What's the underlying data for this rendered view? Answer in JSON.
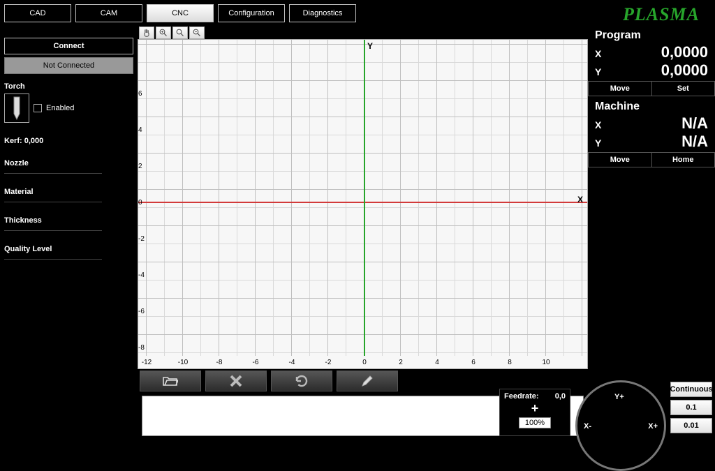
{
  "brand": "PLASMA",
  "tabs": {
    "cad": "CAD",
    "cam": "CAM",
    "cnc": "CNC",
    "config": "Configuration",
    "diag": "Diagnostics",
    "active": "cnc"
  },
  "left": {
    "connect_label": "Connect",
    "status_label": "Not Connected",
    "torch_label": "Torch",
    "enabled_label": "Enabled",
    "kerf_label": "Kerf:",
    "kerf_value": "0,000",
    "nozzle_label": "Nozzle",
    "material_label": "Material",
    "thickness_label": "Thickness",
    "quality_label": "Quality Level"
  },
  "toolbar_icons": {
    "hand": "hand-icon",
    "zoom_in": "zoom-in-icon",
    "zoom_fit": "zoom-fit-icon",
    "zoom_out": "zoom-out-icon"
  },
  "chart_data": {
    "type": "area",
    "title": "",
    "xlabel": "X",
    "ylabel": "Y",
    "xlim": [
      -12,
      11
    ],
    "ylim": [
      -8,
      6
    ],
    "x_ticks": [
      -12,
      -10,
      -8,
      -6,
      -4,
      -2,
      0,
      2,
      4,
      6,
      8,
      10
    ],
    "y_ticks": [
      6,
      4,
      2,
      0,
      -2,
      -4,
      -6,
      -8
    ],
    "series": [],
    "axes": {
      "x_color": "#d23a3a",
      "y_color": "#27a52b",
      "origin": [
        0,
        0
      ]
    }
  },
  "actions": {
    "open": "open",
    "delete": "delete",
    "reload": "reload",
    "edit": "edit"
  },
  "feedrate": {
    "label": "Feedrate:",
    "value": "0,0",
    "percent": "100%"
  },
  "jog": {
    "y_plus": "Y+",
    "x_minus": "X-",
    "x_plus": "X+"
  },
  "step": {
    "continuous": "Continuous",
    "s01": "0.1",
    "s001": "0.01"
  },
  "right": {
    "program": {
      "title": "Program",
      "x_label": "X",
      "x_value": "0,0000",
      "y_label": "Y",
      "y_value": "0,0000",
      "move": "Move",
      "set": "Set"
    },
    "machine": {
      "title": "Machine",
      "x_label": "X",
      "x_value": "N/A",
      "y_label": "Y",
      "y_value": "N/A",
      "move": "Move",
      "home": "Home"
    }
  }
}
